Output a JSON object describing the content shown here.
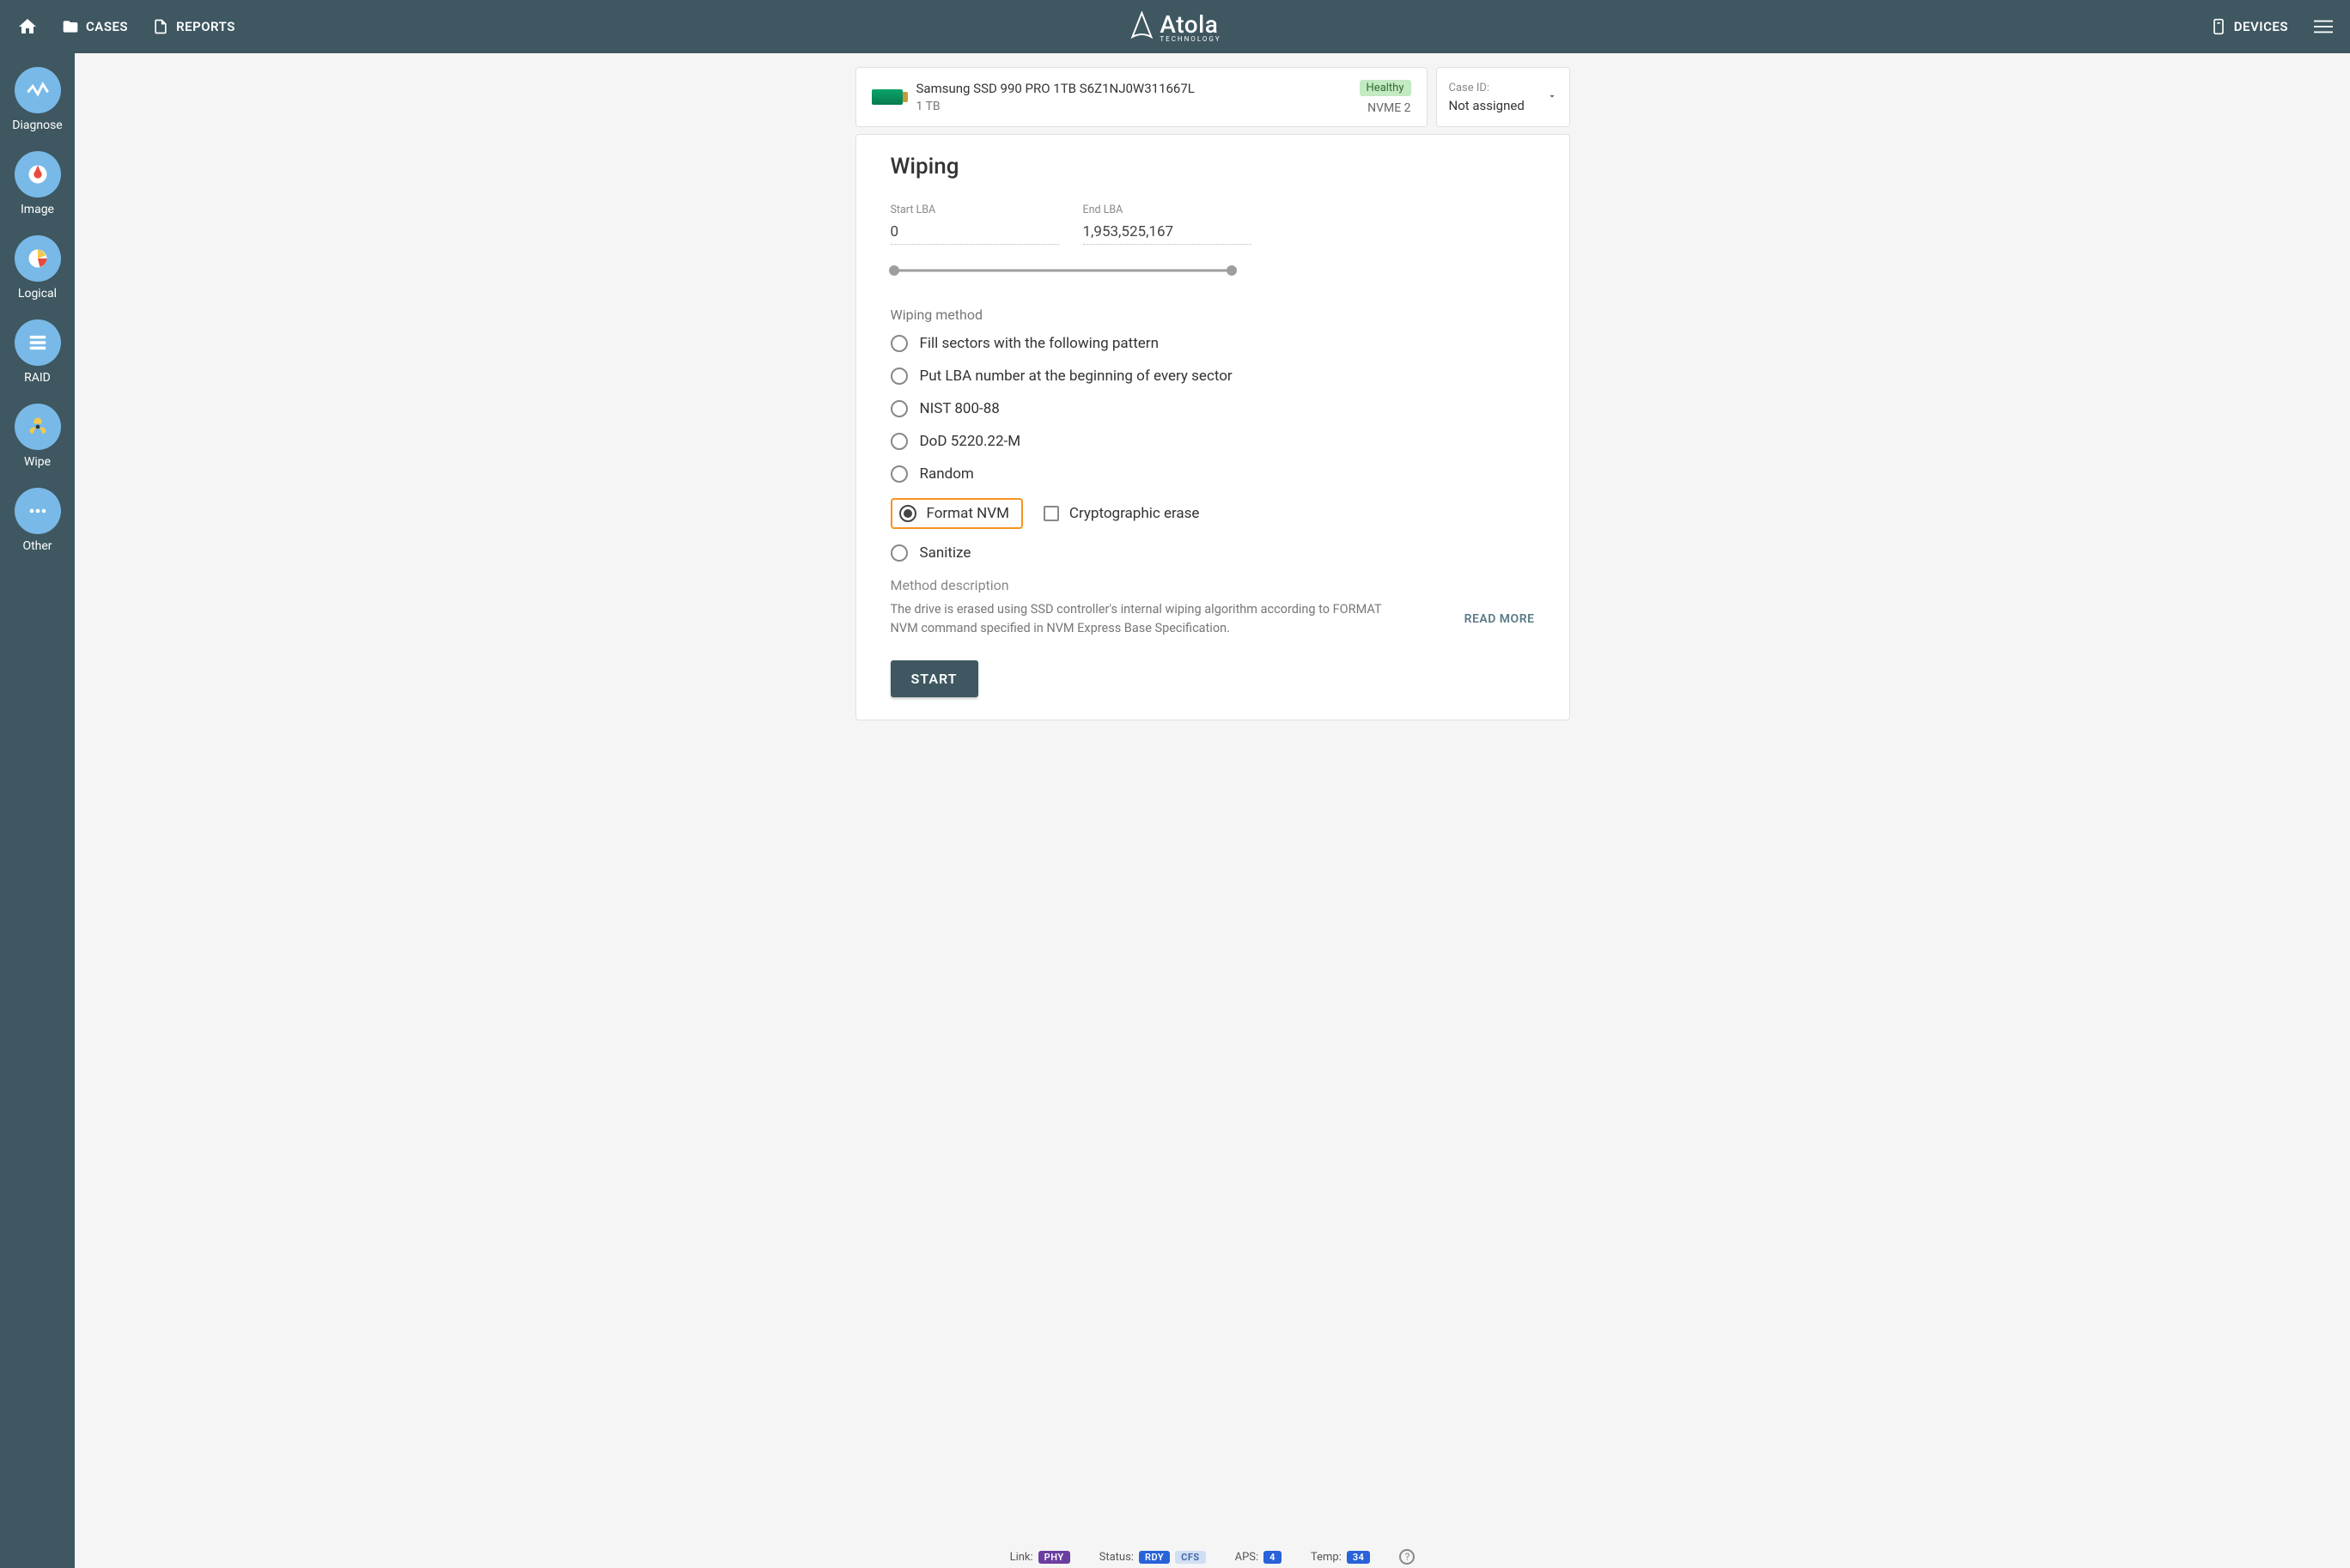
{
  "topbar": {
    "cases": "CASES",
    "reports": "REPORTS",
    "brand": "Atola",
    "brand_sub": "TECHNOLOGY",
    "devices": "DEVICES"
  },
  "sidebar": {
    "items": [
      {
        "label": "Diagnose"
      },
      {
        "label": "Image"
      },
      {
        "label": "Logical"
      },
      {
        "label": "RAID"
      },
      {
        "label": "Wipe"
      },
      {
        "label": "Other"
      }
    ]
  },
  "device": {
    "name": "Samsung SSD 990 PRO 1TB S6Z1NJ0W311667L",
    "size": "1 TB",
    "health": "Healthy",
    "port": "NVME 2"
  },
  "case": {
    "label": "Case ID:",
    "value": "Not assigned"
  },
  "panel": {
    "title": "Wiping",
    "start_lba_label": "Start LBA",
    "start_lba_value": "0",
    "end_lba_label": "End LBA",
    "end_lba_value": "1,953,525,167",
    "method_label": "Wiping method",
    "methods": {
      "fill": "Fill sectors with the following pattern",
      "lba": "Put LBA number at the beginning of every sector",
      "nist": "NIST 800-88",
      "dod": "DoD 5220.22-M",
      "random": "Random",
      "format_nvm": "Format NVM",
      "crypto": "Cryptographic erase",
      "sanitize": "Sanitize"
    },
    "desc_label": "Method description",
    "desc_text": "The drive is erased using SSD controller's internal wiping algorithm according to FORMAT NVM command specified in NVM Express Base Specification.",
    "read_more": "READ MORE",
    "start": "START"
  },
  "footer": {
    "link_label": "Link:",
    "link_badge": "PHY",
    "status_label": "Status:",
    "status_b1": "RDY",
    "status_b2": "CFS",
    "aps_label": "APS:",
    "aps_val": "4",
    "temp_label": "Temp:",
    "temp_val": "34"
  }
}
